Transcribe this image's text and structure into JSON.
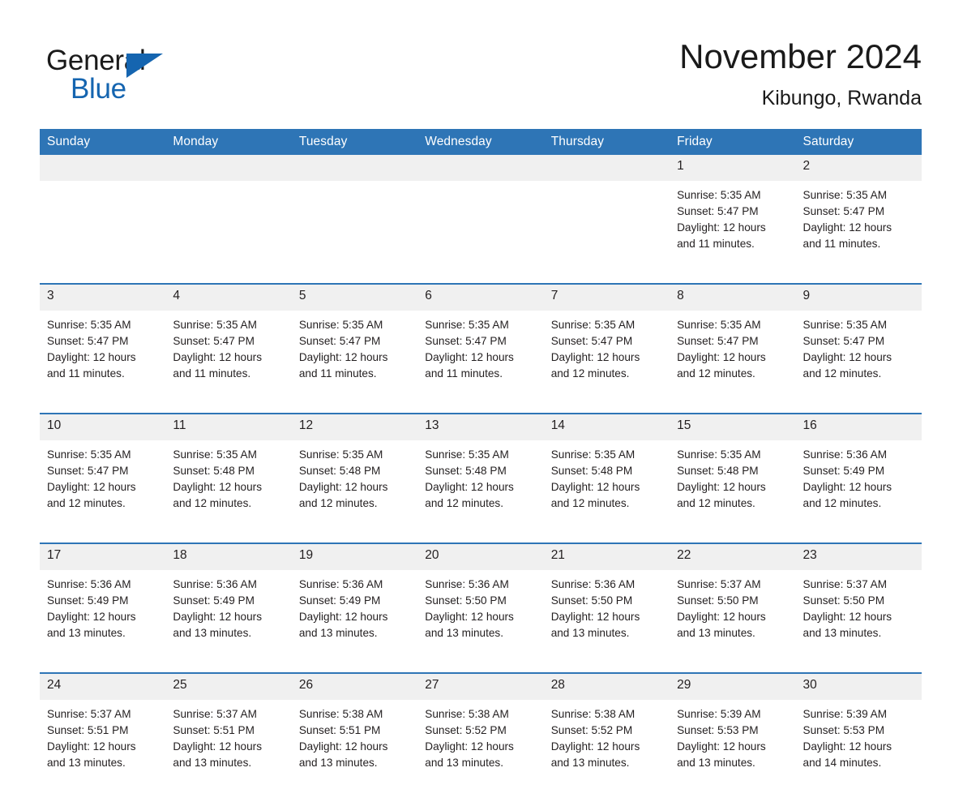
{
  "brand": {
    "name_primary": "General",
    "name_secondary": "Blue"
  },
  "header": {
    "title": "November 2024",
    "subtitle": "Kibungo, Rwanda"
  },
  "colors": {
    "header_blue": "#2e75b6",
    "logo_blue": "#1565b0",
    "daynum_band": "#f0f0f0",
    "text": "#231f20"
  },
  "weekday_headers": [
    "Sunday",
    "Monday",
    "Tuesday",
    "Wednesday",
    "Thursday",
    "Friday",
    "Saturday"
  ],
  "weeks": [
    {
      "days": [
        {
          "num": "",
          "lines": []
        },
        {
          "num": "",
          "lines": []
        },
        {
          "num": "",
          "lines": []
        },
        {
          "num": "",
          "lines": []
        },
        {
          "num": "",
          "lines": []
        },
        {
          "num": "1",
          "lines": [
            "Sunrise: 5:35 AM",
            "Sunset: 5:47 PM",
            "Daylight: 12 hours",
            "and 11 minutes."
          ]
        },
        {
          "num": "2",
          "lines": [
            "Sunrise: 5:35 AM",
            "Sunset: 5:47 PM",
            "Daylight: 12 hours",
            "and 11 minutes."
          ]
        }
      ]
    },
    {
      "days": [
        {
          "num": "3",
          "lines": [
            "Sunrise: 5:35 AM",
            "Sunset: 5:47 PM",
            "Daylight: 12 hours",
            "and 11 minutes."
          ]
        },
        {
          "num": "4",
          "lines": [
            "Sunrise: 5:35 AM",
            "Sunset: 5:47 PM",
            "Daylight: 12 hours",
            "and 11 minutes."
          ]
        },
        {
          "num": "5",
          "lines": [
            "Sunrise: 5:35 AM",
            "Sunset: 5:47 PM",
            "Daylight: 12 hours",
            "and 11 minutes."
          ]
        },
        {
          "num": "6",
          "lines": [
            "Sunrise: 5:35 AM",
            "Sunset: 5:47 PM",
            "Daylight: 12 hours",
            "and 11 minutes."
          ]
        },
        {
          "num": "7",
          "lines": [
            "Sunrise: 5:35 AM",
            "Sunset: 5:47 PM",
            "Daylight: 12 hours",
            "and 12 minutes."
          ]
        },
        {
          "num": "8",
          "lines": [
            "Sunrise: 5:35 AM",
            "Sunset: 5:47 PM",
            "Daylight: 12 hours",
            "and 12 minutes."
          ]
        },
        {
          "num": "9",
          "lines": [
            "Sunrise: 5:35 AM",
            "Sunset: 5:47 PM",
            "Daylight: 12 hours",
            "and 12 minutes."
          ]
        }
      ]
    },
    {
      "days": [
        {
          "num": "10",
          "lines": [
            "Sunrise: 5:35 AM",
            "Sunset: 5:47 PM",
            "Daylight: 12 hours",
            "and 12 minutes."
          ]
        },
        {
          "num": "11",
          "lines": [
            "Sunrise: 5:35 AM",
            "Sunset: 5:48 PM",
            "Daylight: 12 hours",
            "and 12 minutes."
          ]
        },
        {
          "num": "12",
          "lines": [
            "Sunrise: 5:35 AM",
            "Sunset: 5:48 PM",
            "Daylight: 12 hours",
            "and 12 minutes."
          ]
        },
        {
          "num": "13",
          "lines": [
            "Sunrise: 5:35 AM",
            "Sunset: 5:48 PM",
            "Daylight: 12 hours",
            "and 12 minutes."
          ]
        },
        {
          "num": "14",
          "lines": [
            "Sunrise: 5:35 AM",
            "Sunset: 5:48 PM",
            "Daylight: 12 hours",
            "and 12 minutes."
          ]
        },
        {
          "num": "15",
          "lines": [
            "Sunrise: 5:35 AM",
            "Sunset: 5:48 PM",
            "Daylight: 12 hours",
            "and 12 minutes."
          ]
        },
        {
          "num": "16",
          "lines": [
            "Sunrise: 5:36 AM",
            "Sunset: 5:49 PM",
            "Daylight: 12 hours",
            "and 12 minutes."
          ]
        }
      ]
    },
    {
      "days": [
        {
          "num": "17",
          "lines": [
            "Sunrise: 5:36 AM",
            "Sunset: 5:49 PM",
            "Daylight: 12 hours",
            "and 13 minutes."
          ]
        },
        {
          "num": "18",
          "lines": [
            "Sunrise: 5:36 AM",
            "Sunset: 5:49 PM",
            "Daylight: 12 hours",
            "and 13 minutes."
          ]
        },
        {
          "num": "19",
          "lines": [
            "Sunrise: 5:36 AM",
            "Sunset: 5:49 PM",
            "Daylight: 12 hours",
            "and 13 minutes."
          ]
        },
        {
          "num": "20",
          "lines": [
            "Sunrise: 5:36 AM",
            "Sunset: 5:50 PM",
            "Daylight: 12 hours",
            "and 13 minutes."
          ]
        },
        {
          "num": "21",
          "lines": [
            "Sunrise: 5:36 AM",
            "Sunset: 5:50 PM",
            "Daylight: 12 hours",
            "and 13 minutes."
          ]
        },
        {
          "num": "22",
          "lines": [
            "Sunrise: 5:37 AM",
            "Sunset: 5:50 PM",
            "Daylight: 12 hours",
            "and 13 minutes."
          ]
        },
        {
          "num": "23",
          "lines": [
            "Sunrise: 5:37 AM",
            "Sunset: 5:50 PM",
            "Daylight: 12 hours",
            "and 13 minutes."
          ]
        }
      ]
    },
    {
      "days": [
        {
          "num": "24",
          "lines": [
            "Sunrise: 5:37 AM",
            "Sunset: 5:51 PM",
            "Daylight: 12 hours",
            "and 13 minutes."
          ]
        },
        {
          "num": "25",
          "lines": [
            "Sunrise: 5:37 AM",
            "Sunset: 5:51 PM",
            "Daylight: 12 hours",
            "and 13 minutes."
          ]
        },
        {
          "num": "26",
          "lines": [
            "Sunrise: 5:38 AM",
            "Sunset: 5:51 PM",
            "Daylight: 12 hours",
            "and 13 minutes."
          ]
        },
        {
          "num": "27",
          "lines": [
            "Sunrise: 5:38 AM",
            "Sunset: 5:52 PM",
            "Daylight: 12 hours",
            "and 13 minutes."
          ]
        },
        {
          "num": "28",
          "lines": [
            "Sunrise: 5:38 AM",
            "Sunset: 5:52 PM",
            "Daylight: 12 hours",
            "and 13 minutes."
          ]
        },
        {
          "num": "29",
          "lines": [
            "Sunrise: 5:39 AM",
            "Sunset: 5:53 PM",
            "Daylight: 12 hours",
            "and 13 minutes."
          ]
        },
        {
          "num": "30",
          "lines": [
            "Sunrise: 5:39 AM",
            "Sunset: 5:53 PM",
            "Daylight: 12 hours",
            "and 14 minutes."
          ]
        }
      ]
    }
  ]
}
